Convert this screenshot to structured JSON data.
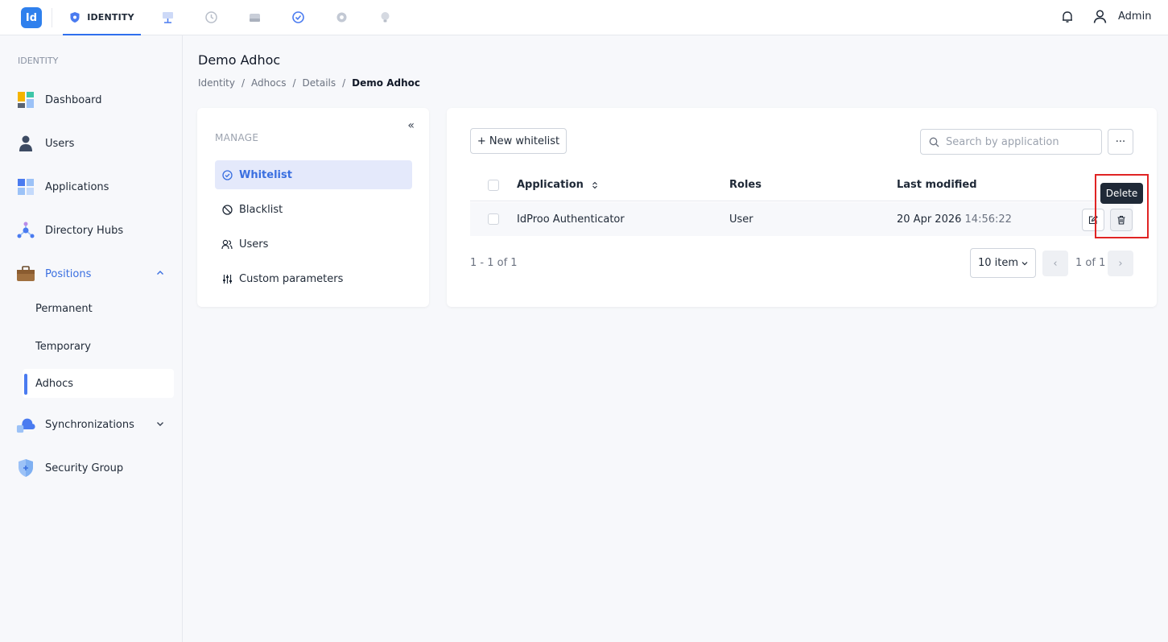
{
  "topbar": {
    "logo": "Id",
    "active_tab": "IDENTITY",
    "admin_label": "Admin",
    "icons": [
      "shield-icon",
      "dashboard-icon",
      "history-icon",
      "server-icon",
      "check-badge-icon",
      "gear-icon",
      "bulb-icon",
      "bell-icon",
      "user-icon"
    ]
  },
  "sidebar": {
    "section": "IDENTITY",
    "items": [
      {
        "label": "Dashboard"
      },
      {
        "label": "Users"
      },
      {
        "label": "Applications"
      },
      {
        "label": "Directory Hubs"
      },
      {
        "label": "Positions"
      },
      {
        "label": "Synchronizations"
      },
      {
        "label": "Security Group"
      }
    ],
    "sub_items": [
      {
        "label": "Permanent"
      },
      {
        "label": "Temporary"
      },
      {
        "label": "Adhocs"
      }
    ]
  },
  "page": {
    "title": "Demo Adhoc",
    "breadcrumb": [
      "Identity",
      "Adhocs",
      "Details",
      "Demo Adhoc"
    ],
    "separator": "/"
  },
  "manage": {
    "collapse": "«",
    "title": "MANAGE",
    "items": [
      {
        "label": "Whitelist"
      },
      {
        "label": "Blacklist"
      },
      {
        "label": "Users"
      },
      {
        "label": "Custom parameters"
      }
    ]
  },
  "toolbar": {
    "new_label": "+ New whitelist",
    "search_placeholder": "Search by application",
    "more_label": "···"
  },
  "table": {
    "headers": [
      "Application",
      "Roles",
      "Last modified"
    ],
    "rows": [
      {
        "application": "IdProo Authenticator",
        "roles": "User",
        "date": "20 Apr 2026",
        "time": "14:56:22"
      }
    ],
    "tooltip": "Delete"
  },
  "pagination": {
    "range": "1 - 1 of 1",
    "page_size": "10 item",
    "page_text": "1 of 1",
    "prev": "‹",
    "next": "›"
  },
  "colors": {
    "accent": "#3a6fe0",
    "highlight": "#e02424"
  }
}
